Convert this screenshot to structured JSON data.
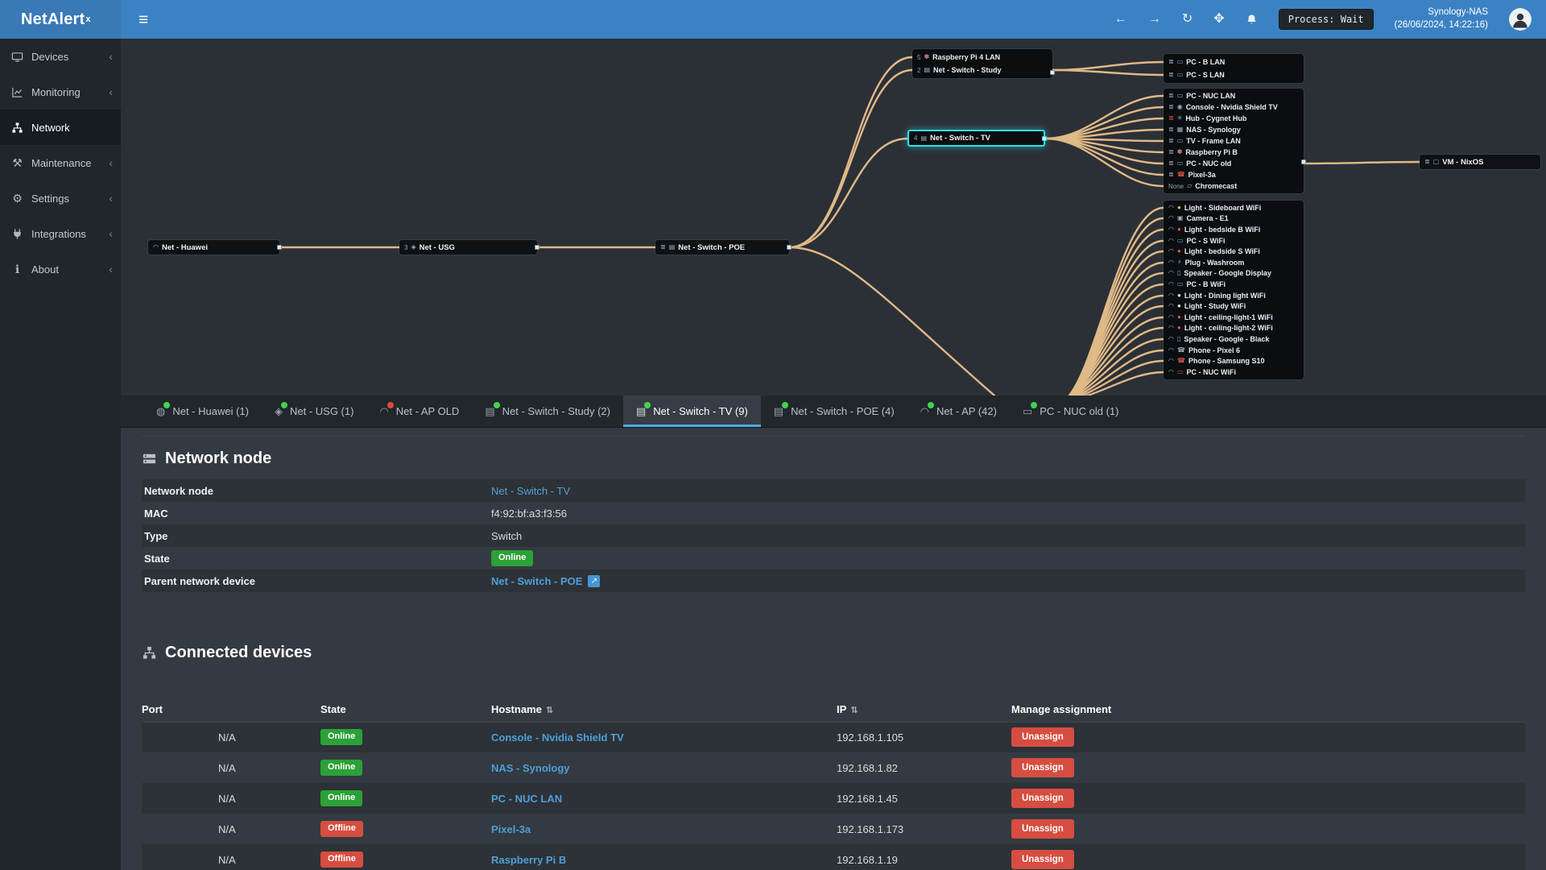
{
  "topbar": {
    "logo_text": "NetAlert",
    "logo_sup": "x",
    "process_status": "Process: Wait",
    "host_name": "Synology-NAS",
    "host_time": "(26/06/2024, 14:22:16)"
  },
  "sidebar": {
    "items": [
      {
        "label": "Devices",
        "icon": "devices-icon",
        "expandable": true
      },
      {
        "label": "Monitoring",
        "icon": "monitoring-icon",
        "expandable": true
      },
      {
        "label": "Network",
        "icon": "network-icon",
        "active": true
      },
      {
        "label": "Maintenance",
        "icon": "maintenance-icon",
        "expandable": true
      },
      {
        "label": "Settings",
        "icon": "settings-icon",
        "expandable": true
      },
      {
        "label": "Integrations",
        "icon": "integrations-icon",
        "expandable": true
      },
      {
        "label": "About",
        "icon": "about-icon",
        "expandable": true
      }
    ]
  },
  "tree": {
    "huawei": {
      "label": "Net - Huawei",
      "icon": "wifi-icon"
    },
    "usg": {
      "port": "3",
      "label": "Net - USG",
      "icon": "shield-icon"
    },
    "poe": {
      "label": "Net - Switch - POE",
      "icon": "switch-icon"
    },
    "study_box": {
      "rows": [
        {
          "port": "5",
          "label": "Raspberry Pi 4 LAN",
          "icon": "raspberry-icon"
        },
        {
          "port": "2",
          "label": "Net - Switch - Study",
          "icon": "switch-icon"
        }
      ]
    },
    "tv": {
      "port": "4",
      "label": "Net - Switch - TV",
      "icon": "switch-icon"
    },
    "study_children": [
      {
        "label": "PC - B LAN",
        "icon": "display-icon"
      },
      {
        "label": "PC - S LAN",
        "icon": "display-icon"
      }
    ],
    "tv_children": [
      {
        "label": "PC - NUC LAN",
        "icon": "display-icon"
      },
      {
        "label": "Console - Nvidia Shield TV",
        "icon": "console-icon"
      },
      {
        "label": "Hub - Cygnet Hub",
        "icon": "hub-icon"
      },
      {
        "label": "NAS - Synology",
        "icon": "nas-icon"
      },
      {
        "label": "TV - Frame LAN",
        "icon": "display-icon"
      },
      {
        "label": "Raspberry Pi B",
        "icon": "raspberry-icon"
      },
      {
        "label": "PC - NUC old",
        "icon": "display-icon"
      },
      {
        "label": "Pixel-3a",
        "icon": "phone-icon"
      },
      {
        "port": "None",
        "label": "Chromecast",
        "icon": "cast-icon"
      }
    ],
    "vm": {
      "label": "VM - NixOS",
      "icon": "vm-icon"
    },
    "ap_children": [
      {
        "label": "Light - Sideboard WiFi",
        "icon": "bulb-icon"
      },
      {
        "label": "Camera - E1",
        "icon": "camera-icon"
      },
      {
        "label": "Light - bedside B WiFi",
        "icon": "bulb-icon"
      },
      {
        "label": "PC - S WiFi",
        "icon": "display-icon"
      },
      {
        "label": "Light - bedside S WiFi",
        "icon": "bulb-icon"
      },
      {
        "label": "Plug - Washroom",
        "icon": "plug-icon"
      },
      {
        "label": "Speaker - Google Display",
        "icon": "speaker-icon"
      },
      {
        "label": "PC - B WiFi",
        "icon": "display-icon"
      },
      {
        "label": "Light - Dining light WiFi",
        "icon": "bulb-icon"
      },
      {
        "label": "Light - Study WiFi",
        "icon": "bulb-icon"
      },
      {
        "label": "Light - ceiling-light-1 WiFi",
        "icon": "bulb-icon"
      },
      {
        "label": "Light - ceiling-light-2 WiFi",
        "icon": "bulb-icon"
      },
      {
        "label": "Speaker - Google - Black",
        "icon": "speaker-icon"
      },
      {
        "label": "Phone - Pixel 6",
        "icon": "phone-icon"
      },
      {
        "label": "Phone - Samsung S10",
        "icon": "phone-icon"
      },
      {
        "label": "PC - NUC WiFi",
        "icon": "display-icon"
      }
    ]
  },
  "tabs": [
    {
      "label": "Net - Huawei (1)",
      "icon": "globe-icon",
      "status": "online"
    },
    {
      "label": "Net - USG (1)",
      "icon": "shield-icon",
      "status": "online"
    },
    {
      "label": "Net - AP OLD",
      "icon": "wifi-icon",
      "status": "offline"
    },
    {
      "label": "Net - Switch - Study (2)",
      "icon": "switch-icon",
      "status": "online"
    },
    {
      "label": "Net - Switch - TV (9)",
      "icon": "switch-icon",
      "status": "online",
      "active": true
    },
    {
      "label": "Net - Switch - POE (4)",
      "icon": "switch-icon",
      "status": "online"
    },
    {
      "label": "Net - AP (42)",
      "icon": "wifi-icon",
      "status": "online"
    },
    {
      "label": "PC - NUC old (1)",
      "icon": "display-icon",
      "status": "online"
    }
  ],
  "node_panel": {
    "title": "Network node",
    "fields": [
      {
        "label": "Network node",
        "value": "Net - Switch - TV",
        "type": "link"
      },
      {
        "label": "MAC",
        "value": "f4:92:bf:a3:f3:56",
        "type": "text"
      },
      {
        "label": "Type",
        "value": "Switch",
        "type": "text"
      },
      {
        "label": "State",
        "value": "Online",
        "type": "badge-online"
      },
      {
        "label": "Parent network device",
        "value": "Net - Switch - POE",
        "type": "link-external"
      }
    ]
  },
  "devices_panel": {
    "title": "Connected devices",
    "headers": {
      "port": "Port",
      "state": "State",
      "hostname": "Hostname",
      "ip": "IP",
      "manage": "Manage assignment"
    },
    "action_label": "Unassign",
    "rows": [
      {
        "port": "N/A",
        "state": "Online",
        "hostname": "Console - Nvidia Shield TV",
        "ip": "192.168.1.105"
      },
      {
        "port": "N/A",
        "state": "Online",
        "hostname": "NAS - Synology",
        "ip": "192.168.1.82"
      },
      {
        "port": "N/A",
        "state": "Online",
        "hostname": "PC - NUC LAN",
        "ip": "192.168.1.45"
      },
      {
        "port": "N/A",
        "state": "Offline",
        "hostname": "Pixel-3a",
        "ip": "192.168.1.173"
      },
      {
        "port": "N/A",
        "state": "Offline",
        "hostname": "Raspberry Pi B",
        "ip": "192.168.1.19"
      }
    ]
  },
  "icon_glyphs": {
    "wifi": "◠",
    "switch": "▤",
    "shield": "◈",
    "display": "▭",
    "raspberry": "✽",
    "phone": "☎",
    "bulb": "●",
    "camera": "▣",
    "speaker": "▯",
    "plug": "⚡",
    "hub": "✳",
    "console": "◉",
    "nas": "▦",
    "cast": "▱",
    "vm": "▢",
    "eth": "≣",
    "globe": "◍",
    "sort": "⇅",
    "chevron": "‹",
    "hamburger": "≡",
    "back": "←",
    "forward": "→",
    "refresh": "↻",
    "move": "✥",
    "external": "↗",
    "maintenance": "⚒",
    "settings": "⚙",
    "about": "ℹ"
  },
  "colors": {
    "topbar_blue": "#3b82c4",
    "online_green": "#2ba137",
    "offline_red": "#d64d41",
    "link_blue": "#55a1d6",
    "edge_orange": "#f0c58e",
    "selection_cyan": "#2ee2e6"
  }
}
